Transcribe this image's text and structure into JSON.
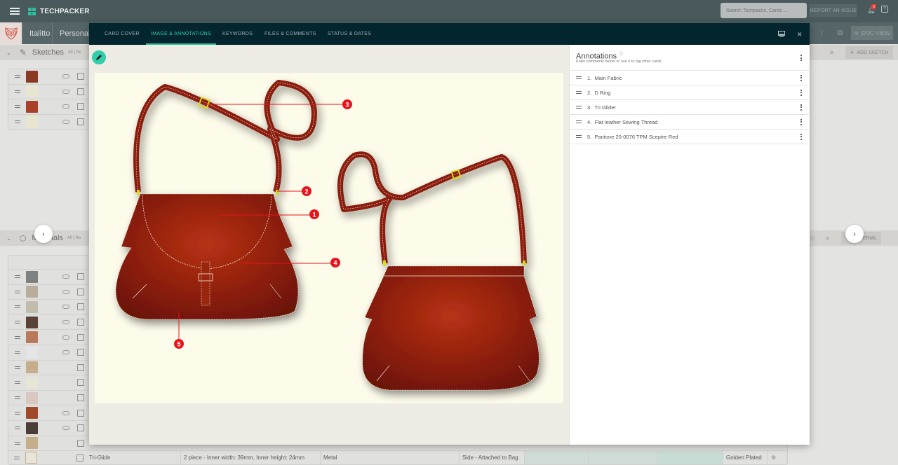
{
  "app": {
    "brand": "TECHPACKER",
    "search_placeholder": "Search Techpacks, Cards ...",
    "report_label": "REPORT AN ISSUE",
    "notification_count": "3"
  },
  "breadcrumb": {
    "brand": "Italitto",
    "project": "Personal"
  },
  "subbar": {
    "doc_view_label": "DOC VIEW",
    "exclaim": "!"
  },
  "sketches": {
    "title": "Sketches",
    "filter": "All | No",
    "add_label": "ADD SKETCH",
    "rows": [
      {
        "thumb_color": "#8a3a22"
      },
      {
        "thumb_color": "#e8e6d0"
      },
      {
        "thumb_color": "#a8402a"
      },
      {
        "thumb_color": "#e8e6d0"
      }
    ]
  },
  "materials": {
    "title": "Materials",
    "filter": "All | No",
    "add_label": "MATERIAL",
    "rows": [
      {
        "thumb_color": "#7d8180",
        "linked": true
      },
      {
        "thumb_color": "#b8ac9c",
        "linked": true
      },
      {
        "thumb_color": "#c2bcac",
        "linked": true
      },
      {
        "thumb_color": "#5a4436",
        "linked": true
      },
      {
        "thumb_color": "#b87a5a",
        "linked": true
      },
      {
        "thumb_color": "#e6e6e6",
        "linked": true
      },
      {
        "thumb_color": "#c7ae8a",
        "linked": false
      },
      {
        "thumb_color": "#e8e4d8",
        "linked": false
      },
      {
        "thumb_color": "#d8c8c0",
        "linked": false
      },
      {
        "thumb_color": "#a04a2a",
        "linked": true
      },
      {
        "thumb_color": "#4a3c36",
        "linked": true
      },
      {
        "thumb_color": "#c7ae8a",
        "linked": false
      }
    ],
    "last_row": {
      "name": "Tri-Glide",
      "description": "2 piece - Inner width: 39mm, Inner height: 24mm",
      "material": "Metal",
      "placement": "Side - Attached to Bag",
      "finish": "Golden Plated"
    }
  },
  "modal": {
    "tabs": [
      {
        "label": "CARD COVER",
        "active": false
      },
      {
        "label": "IMAGE & ANNOTATIONS",
        "active": true
      },
      {
        "label": "KEYWORDS",
        "active": false
      },
      {
        "label": "FILES & COMMENTS",
        "active": false
      },
      {
        "label": "STATUS & DATES",
        "active": false
      }
    ],
    "annotations": {
      "title": "Annotations",
      "info_icon": "ⓘ",
      "subtitle": "Enter comments below or use # to tag other cards",
      "items": [
        {
          "number": "1.",
          "label": "Main Fabric"
        },
        {
          "number": "2.",
          "label": "D Ring"
        },
        {
          "number": "3.",
          "label": "Tri Glider"
        },
        {
          "number": "4.",
          "label": "Flat leather Sewing Thread"
        },
        {
          "number": "5.",
          "label": "Pantone 20-0076 TPM Sceptre Red"
        }
      ]
    },
    "markers": [
      "1",
      "2",
      "3",
      "4",
      "5"
    ],
    "colors": {
      "leather": "#8b1e0c",
      "marker": "#e8141c",
      "accent": "#2fc0a2",
      "hardware": "#d8d81a"
    }
  },
  "nav": {
    "prev": "‹",
    "next": "›"
  }
}
